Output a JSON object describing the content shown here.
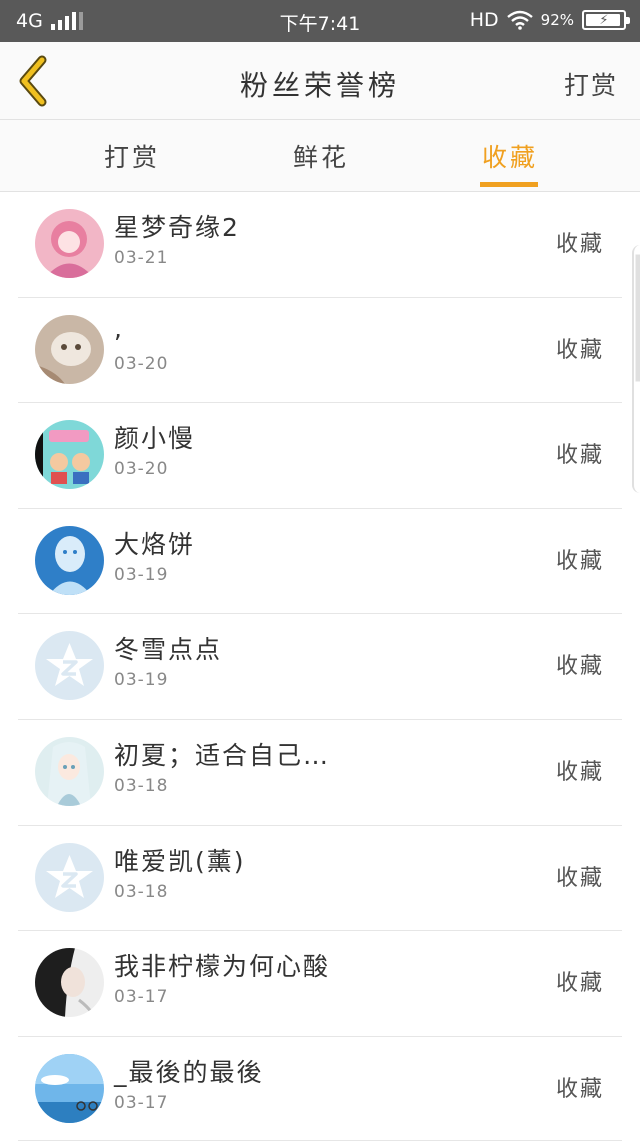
{
  "status_bar": {
    "network": "4G",
    "time": "下午7:41",
    "hd": "HD",
    "battery": "92%"
  },
  "header": {
    "title": "粉丝荣誉榜",
    "action": "打赏"
  },
  "tabs": [
    {
      "label": "打赏"
    },
    {
      "label": "鲜花"
    },
    {
      "label": "收藏"
    }
  ],
  "active_tab": "收藏",
  "colors": {
    "accent": "#f0a020",
    "status_bar": "#595959"
  },
  "fans": [
    {
      "name": "星梦奇缘2",
      "date": "03-21",
      "action": "收藏",
      "avatar": "anime-girl-avatar"
    },
    {
      "name": ",",
      "date": "03-20",
      "action": "收藏",
      "avatar": "cat-photo-avatar"
    },
    {
      "name": "颜小慢",
      "date": "03-20",
      "action": "收藏",
      "avatar": "cartoon-avatar"
    },
    {
      "name": "大烙饼",
      "date": "03-19",
      "action": "收藏",
      "avatar": "blue-face-avatar"
    },
    {
      "name": "冬雪点点",
      "date": "03-19",
      "action": "收藏",
      "avatar": "default-star-avatar"
    },
    {
      "name": "初夏；适合自己…",
      "date": "03-18",
      "action": "收藏",
      "avatar": "anime-girl-avatar"
    },
    {
      "name": "唯爱凯(薰)",
      "date": "03-18",
      "action": "收藏",
      "avatar": "default-star-avatar"
    },
    {
      "name": "我非柠檬为何心酸",
      "date": "03-17",
      "action": "收藏",
      "avatar": "girl-photo-avatar"
    },
    {
      "name": "_最後的最後",
      "date": "03-17",
      "action": "收藏",
      "avatar": "sky-photo-avatar"
    }
  ]
}
